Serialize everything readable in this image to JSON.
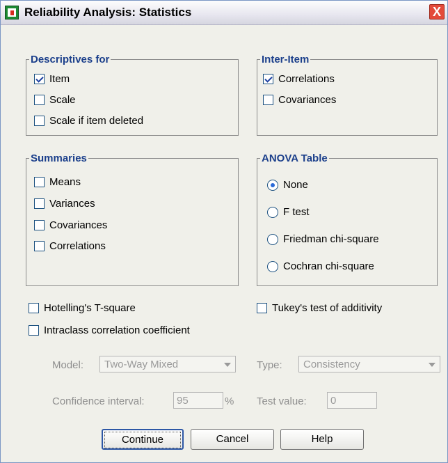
{
  "window": {
    "title": "Reliability Analysis: Statistics",
    "close_glyph": "X"
  },
  "descriptives": {
    "legend": "Descriptives for",
    "items": [
      {
        "label": "Item",
        "checked": true
      },
      {
        "label": "Scale",
        "checked": false
      },
      {
        "label": "Scale if item deleted",
        "checked": false
      }
    ]
  },
  "inter_item": {
    "legend": "Inter-Item",
    "items": [
      {
        "label": "Correlations",
        "checked": true
      },
      {
        "label": "Covariances",
        "checked": false
      }
    ]
  },
  "summaries": {
    "legend": "Summaries",
    "items": [
      {
        "label": "Means",
        "checked": false
      },
      {
        "label": "Variances",
        "checked": false
      },
      {
        "label": "Covariances",
        "checked": false
      },
      {
        "label": "Correlations",
        "checked": false
      }
    ]
  },
  "anova": {
    "legend": "ANOVA Table",
    "options": [
      {
        "label": "None",
        "selected": true
      },
      {
        "label": "F test",
        "selected": false
      },
      {
        "label": "Friedman chi-square",
        "selected": false
      },
      {
        "label": "Cochran chi-square",
        "selected": false
      }
    ]
  },
  "extra": {
    "hotelling": "Hotelling's T-square",
    "tukey": "Tukey's test of additivity",
    "intraclass": "Intraclass correlation coefficient"
  },
  "icc": {
    "model_label": "Model:",
    "model_value": "Two-Way Mixed",
    "type_label": "Type:",
    "type_value": "Consistency",
    "ci_label": "Confidence interval:",
    "ci_value": "95",
    "ci_unit": "%",
    "test_label": "Test value:",
    "test_value": "0"
  },
  "buttons": {
    "continue": "Continue",
    "cancel": "Cancel",
    "help": "Help"
  },
  "colors": {
    "legend": "#1b3f8b",
    "close": "#e34a3a",
    "default_border": "#2d57a5"
  },
  "icons": [
    "spss-app-icon",
    "close-icon",
    "check-icon",
    "radio-dot-icon",
    "dropdown-arrow-icon"
  ]
}
